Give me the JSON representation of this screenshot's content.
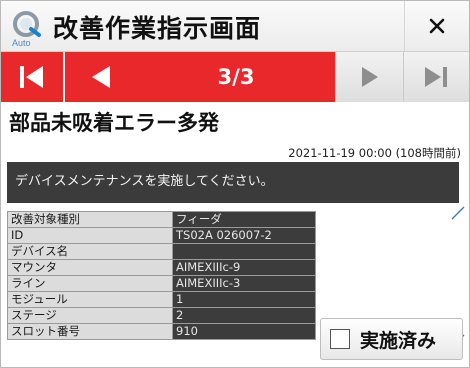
{
  "window": {
    "title": "改善作業指示画面",
    "logo_text": "Auto",
    "icons": {
      "close": "close-icon",
      "logo": "app-logo-icon"
    }
  },
  "navigation": {
    "page_indicator": "3/3",
    "buttons": [
      "first-page",
      "previous-page",
      "next-page",
      "last-page"
    ]
  },
  "error": {
    "title": "部品未吸着エラー多発",
    "timestamp": "2021-11-19 00:00 (108時間前)",
    "message": "デバイスメンテナンスを実施してください。"
  },
  "details": [
    {
      "label": "改善対象種別",
      "value": "フィーダ"
    },
    {
      "label": "ID",
      "value": "TS02A 026007-2"
    },
    {
      "label": "デバイス名",
      "value": ""
    },
    {
      "label": "マウンタ",
      "value": "AIMEXIIIc-9"
    },
    {
      "label": "ライン",
      "value": "AIMEXIIIc-3"
    },
    {
      "label": "モジュール",
      "value": "1"
    },
    {
      "label": "ステージ",
      "value": "2"
    },
    {
      "label": "スロット番号",
      "value": "910"
    }
  ],
  "actions": {
    "done_label": "実施済み",
    "done_checked": false
  },
  "colors": {
    "accent_red": "#e8282b",
    "message_bg": "#3b3b3b",
    "value_bg": "#3c3c3c",
    "label_bg": "#dcdcdc"
  }
}
